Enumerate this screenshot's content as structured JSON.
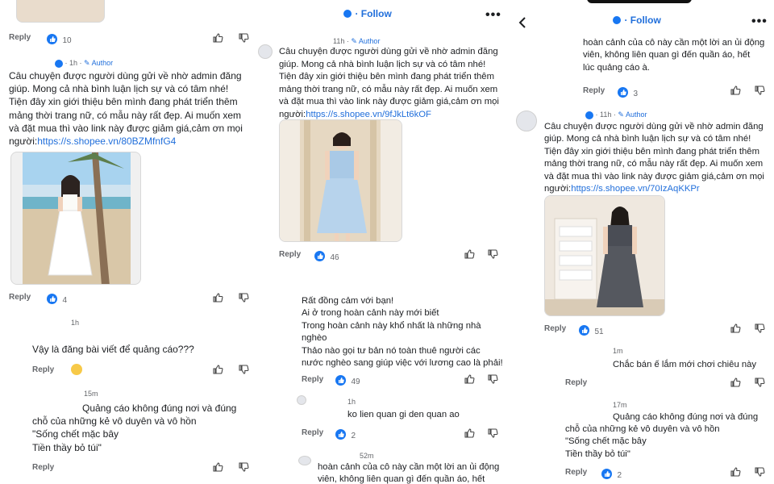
{
  "common": {
    "reply_label": "Reply",
    "author_label": "Author",
    "follow_label": "Follow",
    "more_label": "•••"
  },
  "panel1": {
    "top_like_count": "10",
    "author_time": "1h",
    "post_lines": [
      "Câu chuyện được người dùng gửi về nhờ admin đăng",
      "giúp. Mong cả nhà bình luận lịch sự và có tâm nhé!",
      "Tiện đây xin giới thiệu bên mình đang phát triển thêm",
      "mảng thời trang nữ, có mẫu này rất đẹp. Ai muốn xem",
      "và đặt mua thì vào link này được giảm giá,cảm ơn mọi"
    ],
    "post_last_prefix": "người:",
    "post_link": "https://s.shopee.vn/80BZMfnfG4",
    "post_like_count": "4",
    "c1_time": "1h",
    "c1_text": "Vậy là đăng bài viết để quảng cáo???",
    "c2_time": "15m",
    "c2_lines": [
      "Quảng cáo không đúng nơi và đúng",
      "chỗ của những kẻ vô duyên và vô hồn",
      "\"Sống chết mặc bây",
      "Tiền thầy bỏ túi\""
    ]
  },
  "panel2": {
    "author_time": "11h",
    "post_lines": [
      "Câu chuyện được người dùng gửi về nhờ admin đăng",
      "giúp. Mong cả nhà bình luận lịch sự và có tâm nhé!",
      "Tiện đây xin giới thiệu bên mình đang phát triển thêm",
      "mảng thời trang nữ, có mẫu này rất đẹp. Ai muốn xem",
      "và đặt mua thì vào link này được giảm giá,cảm ơn mọi"
    ],
    "post_last_prefix": "người:",
    "post_link": "https://s.shopee.vn/9fJkLt6kOF",
    "post_like_count": "46",
    "c1_lines": [
      "Rất đồng cảm với bạn!",
      "Ai ở trong hoàn cảnh này mới biết",
      "Trong hoàn cảnh này khổ nhất là những nhà",
      "nghèo",
      "Thảo nào gọi tư bản nó toàn thuê người các",
      "nước nghèo sang giúp việc với lương cao là phải!"
    ],
    "c1_like_count": "49",
    "c2_time": "1h",
    "c2_text": "ko lien quan gi den quan ao",
    "c2_like_count": "2",
    "c3_time": "52m",
    "c3_lines": [
      "hoàn cảnh của cô này cần một lời an ủi động",
      "viên, không liên quan gì đến quần áo, hết"
    ]
  },
  "panel3": {
    "top_lines": [
      "hoàn cảnh của cô này cần một lời an ủi động",
      "viên, không liên quan gì đến quần áo, hết",
      "lúc quảng cáo à."
    ],
    "top_like_count": "3",
    "author_time": "11h",
    "post_lines": [
      "Câu chuyện được người dùng gửi về nhờ admin đăng",
      "giúp. Mong cả nhà bình luận lịch sự và có tâm nhé!",
      "Tiện đây xin giới thiệu bên mình đang phát triển thêm",
      "mảng thời trang nữ, có mẫu này rất đẹp. Ai muốn xem",
      "và đặt mua thì vào link này được giảm giá,cảm ơn mọi"
    ],
    "post_last_prefix": "người:",
    "post_link": "https://s.shopee.vn/70IzAqKKPr",
    "post_like_count": "51",
    "c1_time": "1m",
    "c1_text": "Chắc bán ế lắm mới chơi chiêu này",
    "c2_time": "17m",
    "c2_lines": [
      "Quảng cáo không đúng nơi và đúng",
      "chỗ của những kẻ vô duyên và vô hồn",
      "\"Sống chết mặc bây",
      "Tiền thầy bỏ túi\""
    ],
    "c2_like_count": "2"
  },
  "icons": {
    "like": "thumbs-up-icon",
    "dislike": "thumbs-down-icon",
    "verified": "verified-badge-icon",
    "author": "pencil-icon",
    "back": "chevron-left-icon",
    "haha": "haha-reaction-icon"
  },
  "colors": {
    "link": "#216fdb",
    "like_badge": "#1877f2",
    "muted": "#65676b"
  }
}
